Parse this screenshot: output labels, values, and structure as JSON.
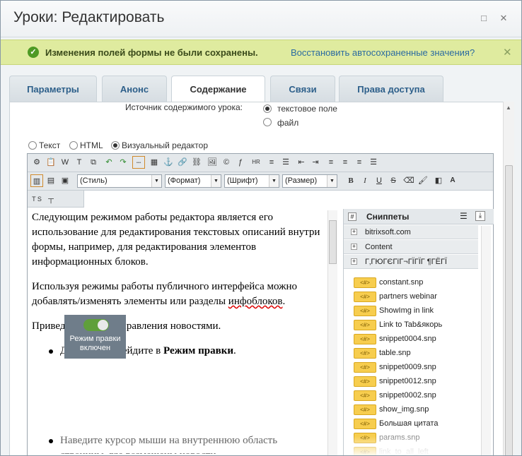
{
  "window": {
    "title": "Уроки: Редактировать"
  },
  "notice": {
    "message": "Изменения полей формы не были сохранены.",
    "link": "Восстановить автосохраненные значения?"
  },
  "tabs": [
    {
      "label": "Параметры"
    },
    {
      "label": "Анонс"
    },
    {
      "label": "Содержание"
    },
    {
      "label": "Связи"
    },
    {
      "label": "Права доступа"
    }
  ],
  "source": {
    "label": "Источник содержимого урока:",
    "opt1": "текстовое поле",
    "opt2": "файл"
  },
  "mode": {
    "text": "Текст",
    "html": "HTML",
    "visual": "Визуальный редактор"
  },
  "toolbar": {
    "style": "(Стиль)",
    "format": "(Формат)",
    "font": "(Шрифт)",
    "size": "(Размер)",
    "ts": "T S"
  },
  "content": {
    "p1": "Следующим режимом работы редактора является его использование для редактирования текстовых описаний внутри формы, например, для редактирования элементов информационных блоков.",
    "p2a": "Используя режимы работы публичного интерфейса можно добавлять/изменять элементы или разделы ",
    "p2b": "инфоблоков",
    "p2c": ".",
    "p3": "Приведем пример управления новостями.",
    "b1a": "Для этого перейдите в ",
    "b1b": "Режим правки",
    "b1c": ".",
    "img": "Режим правки включен",
    "b2": "Наведите курсор мыши на внутреннюю область страницы, где размещены новости."
  },
  "snippets": {
    "title": "Сниппеты",
    "groups": [
      "bitrixsoft.com",
      "Content",
      "Г‚ГЮГЄГїГ¬ГЇГЇГ ¶ГЁГЇ"
    ],
    "badge": "<#>",
    "items": [
      "constant.snp",
      "partners webinar",
      "ShowImg in link",
      "Link to Tab&якорь",
      "snippet0004.snp",
      "table.snp",
      "snippet0009.snp",
      "snippet0012.snp",
      "snippet0002.snp",
      "show_img.snp",
      "Большая цитата",
      "params.snp",
      "link_to_all_left"
    ]
  }
}
